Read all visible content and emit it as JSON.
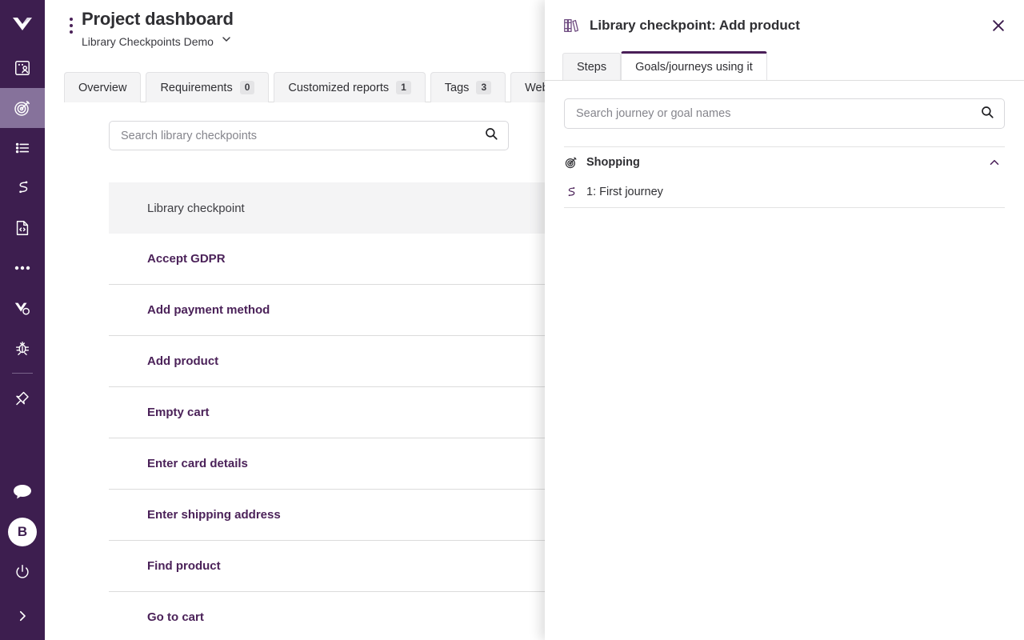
{
  "rail": {
    "items": [
      {
        "name": "logo",
        "icon": "vwo-logo-icon",
        "active": false
      },
      {
        "name": "persona",
        "icon": "persona-icon",
        "active": false
      },
      {
        "name": "goals",
        "icon": "target-icon",
        "active": true
      },
      {
        "name": "checkpoints",
        "icon": "list-icon",
        "active": false
      },
      {
        "name": "journeys",
        "icon": "journey-path-icon",
        "active": false
      },
      {
        "name": "code",
        "icon": "code-file-icon",
        "active": false
      },
      {
        "name": "more",
        "icon": "more-dots-icon",
        "active": false
      },
      {
        "name": "integrations",
        "icon": "v-gear-icon",
        "active": false
      },
      {
        "name": "bugs",
        "icon": "bug-icon",
        "active": false
      },
      {
        "name": "plugins",
        "icon": "pin-plug-icon",
        "active": false
      }
    ],
    "chat_icon": "chat-bubble-icon",
    "avatar_initial": "B",
    "power_icon": "power-icon",
    "expand_icon": "chevron-right-icon"
  },
  "header": {
    "kebab_icon": "kebab-menu-icon",
    "title": "Project dashboard",
    "subtitle": "Library Checkpoints Demo",
    "subtitle_caret": "chevron-down-icon"
  },
  "tabs": [
    {
      "label": "Overview",
      "badge": null
    },
    {
      "label": "Requirements",
      "badge": "0"
    },
    {
      "label": "Customized reports",
      "badge": "1"
    },
    {
      "label": "Tags",
      "badge": "3"
    },
    {
      "label": "Webhooks",
      "badge": null
    }
  ],
  "search": {
    "placeholder": "Search library checkpoints",
    "value": "",
    "icon": "search-icon"
  },
  "list": {
    "header_label": "Library checkpoint",
    "rows": [
      {
        "label": "Accept GDPR"
      },
      {
        "label": "Add payment method"
      },
      {
        "label": "Add product"
      },
      {
        "label": "Empty cart"
      },
      {
        "label": "Enter card details"
      },
      {
        "label": "Enter shipping address"
      },
      {
        "label": "Find product"
      },
      {
        "label": "Go to cart"
      }
    ]
  },
  "panel": {
    "icon": "books-library-icon",
    "title": "Library checkpoint: Add product",
    "close_icon": "close-icon",
    "tabs": [
      {
        "label": "Steps",
        "active": false
      },
      {
        "label": "Goals/journeys using it",
        "active": true
      }
    ],
    "search": {
      "placeholder": "Search journey or goal names",
      "value": "",
      "icon": "search-icon"
    },
    "groups": [
      {
        "icon": "target-icon",
        "name": "Shopping",
        "collapse_icon": "chevron-up-icon",
        "journeys": [
          {
            "icon": "journey-path-icon",
            "name": "1: First journey"
          }
        ]
      }
    ]
  },
  "colors": {
    "rail_bg": "#3d1e4f",
    "rail_active": "#86729b",
    "accent_purple": "#4b2259",
    "tab_active_border": "#4a1f58",
    "row_header_bg": "#f4f4f5",
    "row_border": "#dcdcdc"
  }
}
